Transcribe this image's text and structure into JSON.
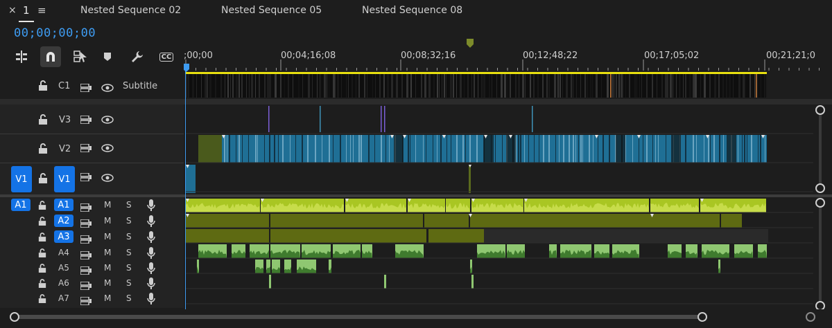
{
  "tabs": {
    "close": "×",
    "current_index": "1",
    "menu": "≡",
    "items": [
      "Nested Sequence 02",
      "Nested Sequence 05",
      "Nested Sequence 08"
    ]
  },
  "timecode": "00;00;00;00",
  "ruler": {
    "labels": [
      ";00;00",
      "00;04;16;08",
      "00;08;32;16",
      "00;12;48;22",
      "00;17;05;02",
      "00;21;21;0"
    ]
  },
  "toolbar": {
    "icons": [
      "insert-overwrite-icon",
      "snap-icon",
      "linked-selection-icon",
      "marker-icon",
      "wrench-icon",
      "captions-icon"
    ],
    "captions_label": "CC"
  },
  "tracks": {
    "caption": {
      "name": "C1",
      "label": "Subtitle"
    },
    "video": [
      {
        "name": "V3"
      },
      {
        "name": "V2"
      },
      {
        "name": "V1",
        "source": "V1"
      }
    ],
    "audio": [
      {
        "name": "A1",
        "source": "A1",
        "m": "M",
        "s": "S"
      },
      {
        "name": "A2",
        "m": "M",
        "s": "S"
      },
      {
        "name": "A3",
        "m": "M",
        "s": "S"
      },
      {
        "name": "A4",
        "m": "M",
        "s": "S"
      },
      {
        "name": "A5",
        "m": "M",
        "s": "S"
      },
      {
        "name": "A6",
        "m": "M",
        "s": "S"
      },
      {
        "name": "A7",
        "m": "M",
        "s": "S"
      }
    ]
  },
  "colors": {
    "accent": "#3e9cf2",
    "video_clip": "#1f6f95",
    "video_clip_olive": "#4a5a1c",
    "audio_clip_bright": "#a9c623",
    "audio_clip_olive": "#5e6a12",
    "audio_clip_green": "#8fc771",
    "work_area": "#e8e010",
    "playhead": "#3e9cf2",
    "button_blue": "#1473e6"
  }
}
